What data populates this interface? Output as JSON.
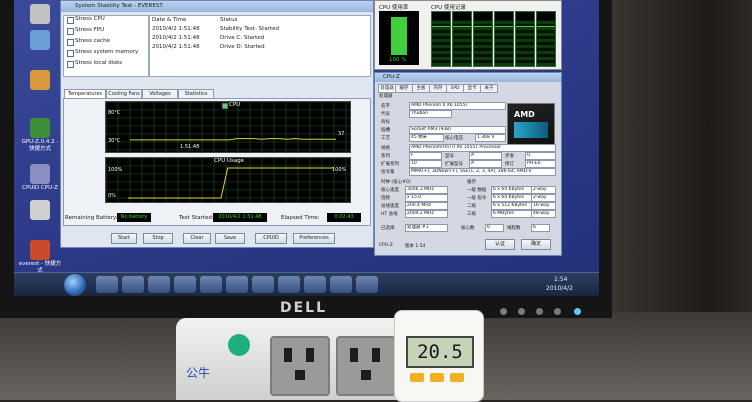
{
  "desktop_icons": [
    {
      "label": "",
      "color": "#c2c2c2"
    },
    {
      "label": "",
      "color": "#6aa0d8"
    },
    {
      "label": "",
      "color": "#d89a3a"
    },
    {
      "label": "GPU-Z.0.4.2 - 快捷方式",
      "color": "#3f8e3a"
    },
    {
      "label": "CPUID CPU-Z",
      "color": "#8a8fbf"
    },
    {
      "label": "",
      "color": "#d0d0d0"
    },
    {
      "label": "everest - 快捷方式",
      "color": "#c94a2a"
    }
  ],
  "stability": {
    "title": "System Stability Test - EVEREST",
    "checks": [
      {
        "label": "Stress CPU"
      },
      {
        "label": "Stress FPU"
      },
      {
        "label": "Stress cache"
      },
      {
        "label": "Stress system memory"
      },
      {
        "label": "Stress local disks"
      }
    ],
    "log_headers": {
      "datetime": "Date & Time",
      "status": "Status"
    },
    "log": [
      {
        "time": "2010/4/2 1:51:48",
        "status": "Stability Test: Started"
      },
      {
        "time": "2010/4/2 1:51:48",
        "status": "Drive C: Started"
      },
      {
        "time": "2010/4/2 1:51:48",
        "status": "Drive D: Started"
      }
    ],
    "tabs": [
      "Temperatures",
      "Cooling Fans",
      "Voltages",
      "Statistics"
    ],
    "temp_graph": {
      "legend": "CPU",
      "ymax": "80°C",
      "ymin": "30°C",
      "time": "1:51:48",
      "current": "37",
      "temps": [
        36,
        36,
        36,
        36,
        36,
        36,
        36,
        36,
        36,
        36,
        36,
        36,
        36,
        38,
        38,
        38,
        37,
        38,
        38,
        37,
        38,
        37,
        37,
        37,
        37,
        37
      ]
    },
    "usage_graph": {
      "title": "CPU Usage",
      "ymax": "100%",
      "ymin": "0%",
      "current": "100%",
      "usage": [
        0,
        0,
        0,
        0,
        0,
        0,
        0,
        0,
        0,
        0,
        0,
        0,
        0,
        0,
        0,
        100,
        100,
        100,
        100,
        100,
        100,
        100,
        100,
        100,
        100,
        100,
        100,
        100,
        100,
        100,
        100,
        100
      ]
    },
    "remaining_battery_label": "Remaining Battery:",
    "remaining_battery": "No battery",
    "test_started_label": "Test Started:",
    "test_started": "2010/4/2 1:51:48",
    "elapsed_label": "Elapsed Time:",
    "elapsed": "0:02:43",
    "buttons": [
      "Start",
      "Stop",
      "Clear",
      "Save",
      "CPUID",
      "Preferences"
    ]
  },
  "cpu_meter": {
    "usage_label": "CPU 使用率",
    "history_label": "CPU 使用记录",
    "percent": "100 %",
    "fill": 1.0,
    "history_cells": 6
  },
  "cpuz": {
    "title": "CPU-Z",
    "tabs": [
      "处理器",
      "缓存",
      "主板",
      "内存",
      "SPD",
      "显卡",
      "关于"
    ],
    "section": "处理器",
    "name_label": "名字",
    "name": "AMD Phenom II X6 1055T",
    "codename_label": "代号",
    "codename": "Thuban",
    "brand_label": "商标",
    "package_label": "插槽",
    "package": "Socket AM3 (938)",
    "tech_label": "工艺",
    "tech": "45 纳米",
    "voltage_label": "核心电压",
    "voltage": "1.368 V",
    "spec_label": "规格",
    "spec": "AMD Phenom(tm) II X6 1055T Processor",
    "family_label": "系列",
    "family": "F",
    "model_label": "型号",
    "model": "A",
    "stepping_label": "步进",
    "stepping": "0",
    "ext_family_label": "扩展系列",
    "ext_family": "10",
    "ext_model_label": "扩展型号",
    "ext_model": "A",
    "revision_label": "修订",
    "revision": "PH-E0",
    "instr_label": "指令集",
    "instr": "MMX(+), 3DNow!(+), SSE(1, 2, 3, 4A), x86-64, AMD-V",
    "clocks_label": "时钟 (核心#0)",
    "core_speed_label": "核心速度",
    "core_speed": "3006.3 MHz",
    "multiplier_label": "倍频",
    "multiplier": "x 15.0",
    "bus_label": "总线速度",
    "bus": "200.4 MHz",
    "ht_label": "HT 总线",
    "ht": "2004.2 MHz",
    "cache_label": "缓存",
    "l1d_label": "一级 数据",
    "l1d": "6 x 64 KBytes",
    "l1d_way": "2-way",
    "l1i_label": "一级 指令",
    "l1i": "6 x 64 KBytes",
    "l1i_way": "2-way",
    "l2_label": "二级",
    "l2": "6 x 512 KBytes",
    "l2_way": "16-way",
    "l3_label": "三级",
    "l3": "6 MBytes",
    "l3_way": "48-way",
    "selected_label": "已选择",
    "selected": "处理器 #1",
    "cores_label": "核心数",
    "cores": "6",
    "threads_label": "线程数",
    "threads": "6",
    "version_label": "CPU-Z",
    "version": "版本 1.54",
    "validate": "认证",
    "ok": "确定"
  },
  "taskbar": {
    "time": "1:54",
    "date": "2010/4/2"
  },
  "monitor_brand": "DELL",
  "power_meter": {
    "reading": "20.5",
    "brand_text": "公牛"
  }
}
